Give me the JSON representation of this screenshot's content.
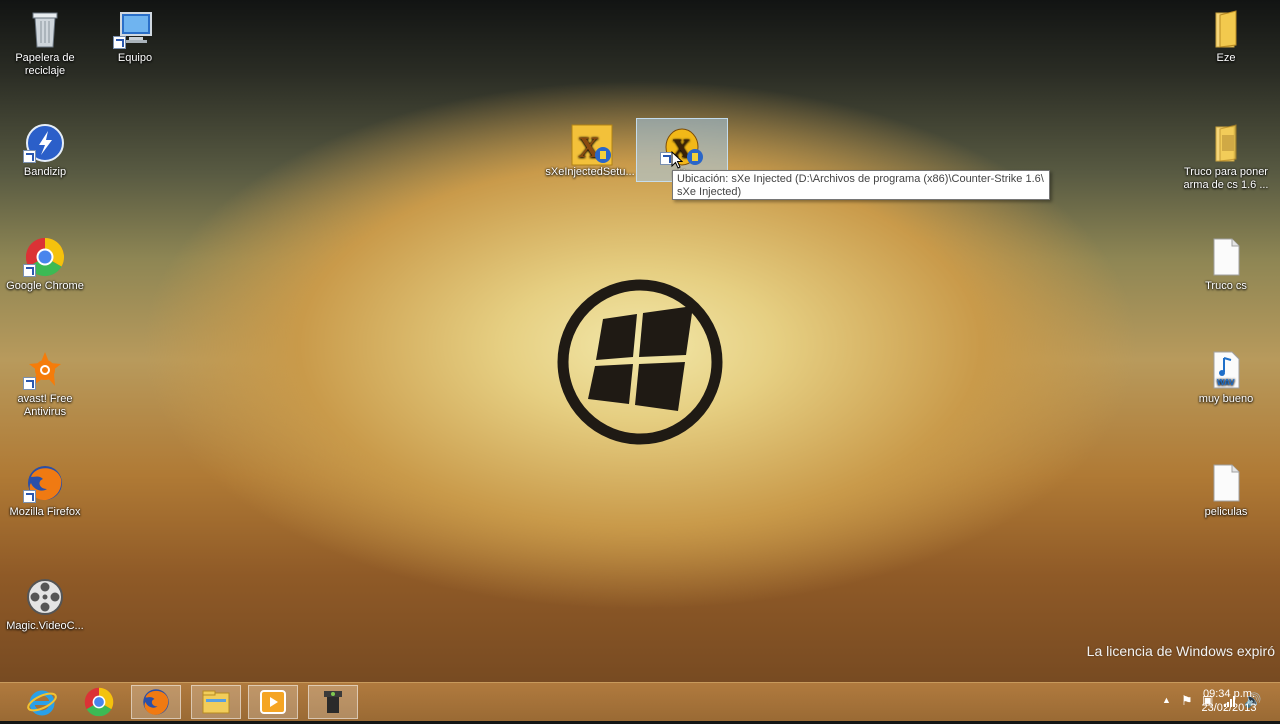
{
  "desktop": {
    "left_icons": [
      {
        "label": "Papelera de reciclaje",
        "icon": "recycle-bin-icon"
      },
      {
        "label": "Equipo",
        "icon": "computer-icon"
      },
      {
        "label": "Bandizip",
        "icon": "bandizip-icon"
      },
      {
        "label": "Google Chrome",
        "icon": "chrome-icon"
      },
      {
        "label": "avast! Free Antivirus",
        "icon": "avast-icon"
      },
      {
        "label": "Mozilla Firefox",
        "icon": "firefox-icon"
      },
      {
        "label": "Magic.VideoC...",
        "icon": "video-reel-icon"
      }
    ],
    "center_icons": [
      {
        "label": "sXeInjectedSetu...",
        "icon": "sxe-setup-icon"
      },
      {
        "label": "sXe",
        "icon": "sxe-injected-icon"
      }
    ],
    "right_icons": [
      {
        "label": "Eze",
        "icon": "folder-icon"
      },
      {
        "label": "Truco para poner arma de cs 1.6 ...",
        "icon": "folder-icon"
      },
      {
        "label": "Truco cs",
        "icon": "text-file-icon"
      },
      {
        "label": "muy bueno",
        "icon": "wav-file-icon"
      },
      {
        "label": "peliculas",
        "icon": "text-file-icon"
      }
    ]
  },
  "tooltip": {
    "line1": "Ubicación: sXe Injected (D:\\Archivos de programa (x86)\\Counter-Strike 1.6\\",
    "line2": "sXe Injected)"
  },
  "watermark": "La licencia de Windows expiró",
  "taskbar": {
    "apps": [
      "internet-explorer-icon",
      "chrome-icon",
      "firefox-icon",
      "file-explorer-icon",
      "media-player-icon",
      "video-camera-icon"
    ],
    "clock_time": "09:34 p.m.",
    "clock_date": "23/02/2013"
  }
}
